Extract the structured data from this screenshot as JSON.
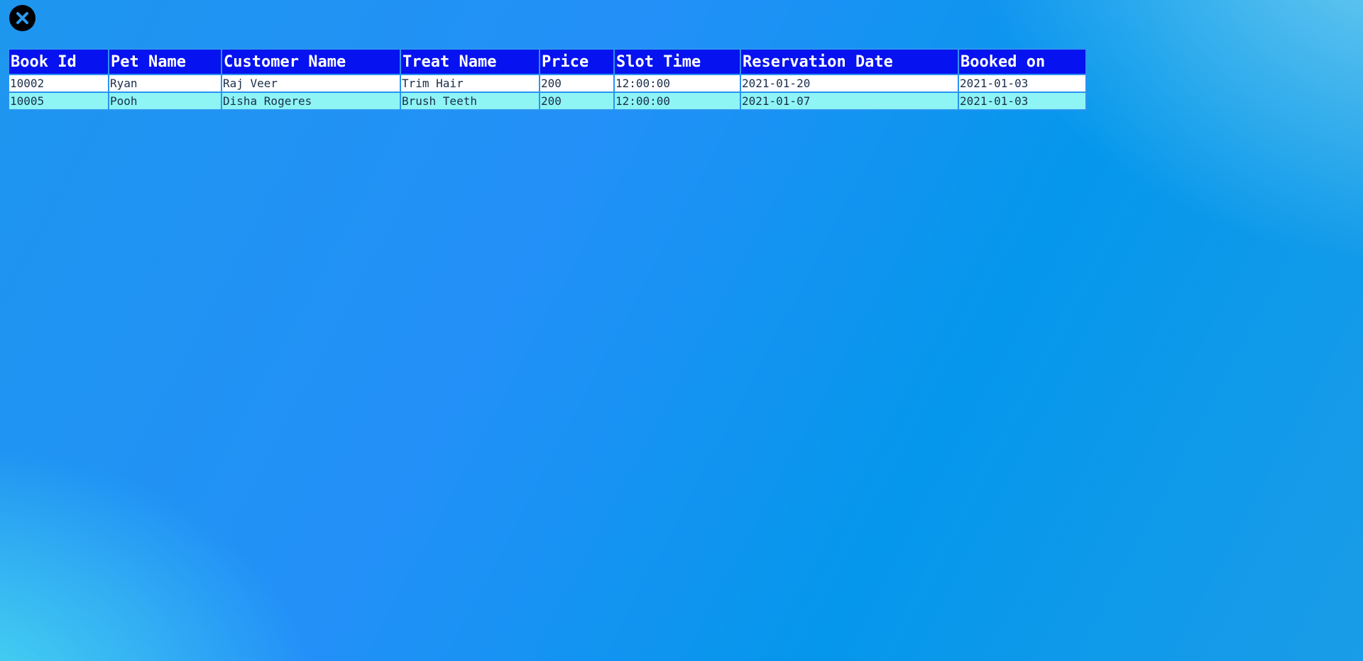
{
  "toolbar": {
    "close_icon": "close-icon"
  },
  "table": {
    "headers": [
      "Book Id",
      "Pet Name",
      "Customer Name",
      "Treat Name",
      "Price",
      "Slot Time",
      "Reservation Date",
      "Booked on"
    ],
    "rows": [
      [
        "10002",
        "Ryan",
        "Raj Veer",
        "Trim Hair",
        "200",
        "12:00:00",
        "2021-01-20",
        "2021-01-03"
      ],
      [
        "10005",
        "Pooh",
        "Disha Rogeres",
        "Brush Teeth",
        "200",
        "12:00:00",
        "2021-01-07",
        "2021-01-03"
      ]
    ]
  },
  "colors": {
    "header_bg": "#0612f0",
    "row_odd_bg": "#ffffff",
    "row_even_bg": "#8ef4f4",
    "background_accent": "#2390f8"
  }
}
